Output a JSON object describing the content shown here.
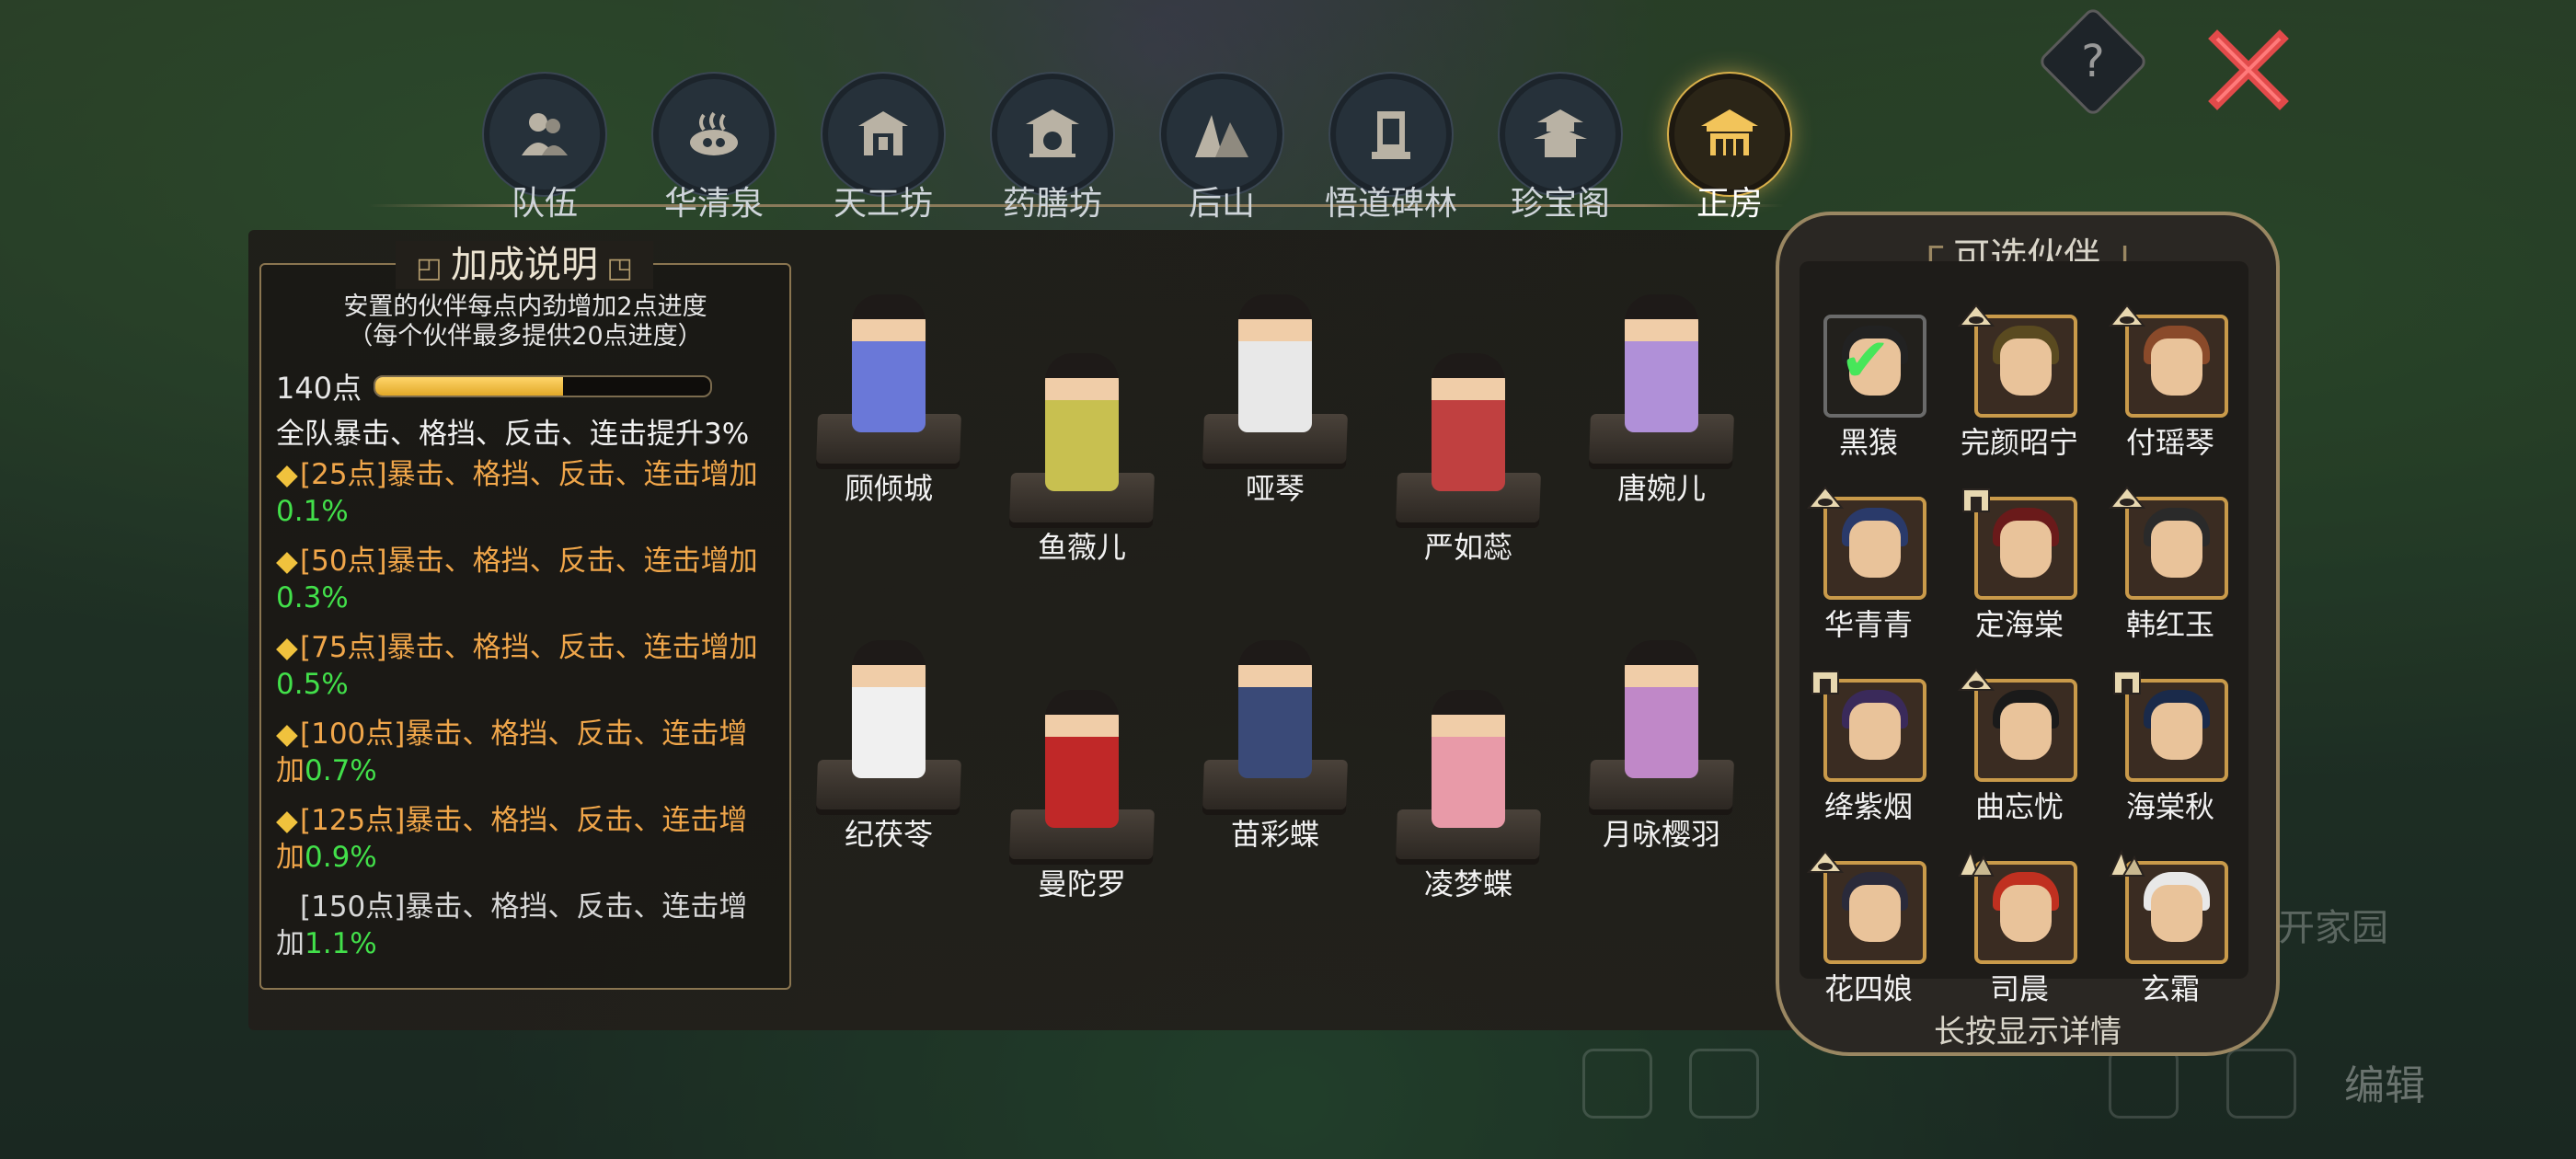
{
  "nav": {
    "tabs": [
      {
        "label": "队伍",
        "icon": "people-icon",
        "active": false
      },
      {
        "label": "华清泉",
        "icon": "hot-spring-icon",
        "active": false
      },
      {
        "label": "天工坊",
        "icon": "workshop-icon",
        "active": false
      },
      {
        "label": "药膳坊",
        "icon": "kitchen-icon",
        "active": false
      },
      {
        "label": "后山",
        "icon": "mountain-icon",
        "active": false
      },
      {
        "label": "悟道碑林",
        "icon": "stele-icon",
        "active": false
      },
      {
        "label": "珍宝阁",
        "icon": "pavilion-icon",
        "active": false
      },
      {
        "label": "正房",
        "icon": "main-hall-icon",
        "active": true
      }
    ]
  },
  "help_label": "?",
  "bonus": {
    "title": "加成说明",
    "desc_line1": "安置的伙伴每点内劲增加2点进度",
    "desc_line2": "（每个伙伴最多提供20点进度）",
    "points_label": "140点",
    "progress": 0.56,
    "team_bonus": "全队暴击、格挡、反击、连击提升3%",
    "tiers": [
      {
        "text": "[25点]暴击、格挡、反击、连击增加",
        "value": "0.1%",
        "unlocked": true
      },
      {
        "text": "[50点]暴击、格挡、反击、连击增加",
        "value": "0.3%",
        "unlocked": true
      },
      {
        "text": "[75点]暴击、格挡、反击、连击增加",
        "value": "0.5%",
        "unlocked": true
      },
      {
        "text": "[100点]暴击、格挡、反击、连击增加",
        "value": "0.7%",
        "unlocked": true
      },
      {
        "text": "[125点]暴击、格挡、反击、连击增加",
        "value": "0.9%",
        "unlocked": true
      },
      {
        "text": "[150点]暴击、格挡、反击、连击增加",
        "value": "1.1%",
        "unlocked": false
      }
    ]
  },
  "placed": [
    {
      "name": "顾倾城",
      "color": "#6a78d8"
    },
    {
      "name": "鱼薇儿",
      "color": "#c8c050"
    },
    {
      "name": "哑琴",
      "color": "#e8e8e8"
    },
    {
      "name": "严如蕊",
      "color": "#c04040"
    },
    {
      "name": "唐婉儿",
      "color": "#b090d8"
    },
    {
      "name": "纪茯苓",
      "color": "#f0f0f0"
    },
    {
      "name": "曼陀罗",
      "color": "#c02828"
    },
    {
      "name": "苗彩蝶",
      "color": "#3a4a78"
    },
    {
      "name": "凌梦蝶",
      "color": "#e89aa8"
    },
    {
      "name": "月咏樱羽",
      "color": "#c088c8"
    }
  ],
  "partners": {
    "title": "可选伙伴",
    "items": [
      {
        "name": "黑猿",
        "selected": true,
        "hair": "#222222",
        "badge": ""
      },
      {
        "name": "完颜昭宁",
        "selected": false,
        "hair": "#5a4a20",
        "badge": "eye-badge-icon"
      },
      {
        "name": "付瑶琴",
        "selected": false,
        "hair": "#8a4a2a",
        "badge": "eye-badge-icon"
      },
      {
        "name": "华青青",
        "selected": false,
        "hair": "#2a3a6a",
        "badge": "eye-badge-icon"
      },
      {
        "name": "定海棠",
        "selected": false,
        "hair": "#6a1a1a",
        "badge": "gate-badge-icon"
      },
      {
        "name": "韩红玉",
        "selected": false,
        "hair": "#2a2a2a",
        "badge": "eye-badge-icon"
      },
      {
        "name": "绛紫烟",
        "selected": false,
        "hair": "#3a2a5a",
        "badge": "gate-badge-icon"
      },
      {
        "name": "曲忘忧",
        "selected": false,
        "hair": "#1a1a1a",
        "badge": "eye-badge-icon"
      },
      {
        "name": "海棠秋",
        "selected": false,
        "hair": "#1a2a4a",
        "badge": "gate-badge-icon"
      },
      {
        "name": "花四娘",
        "selected": false,
        "hair": "#2a2a3a",
        "badge": "eye-badge-icon"
      },
      {
        "name": "司晨",
        "selected": false,
        "hair": "#c03020",
        "badge": "mountain-badge-icon"
      },
      {
        "name": "玄霜",
        "selected": false,
        "hair": "#e8e8e8",
        "badge": "mountain-badge-icon"
      }
    ],
    "hint": "长按显示详情"
  },
  "background": {
    "home_label": "开家园",
    "edit_label": "编辑"
  }
}
